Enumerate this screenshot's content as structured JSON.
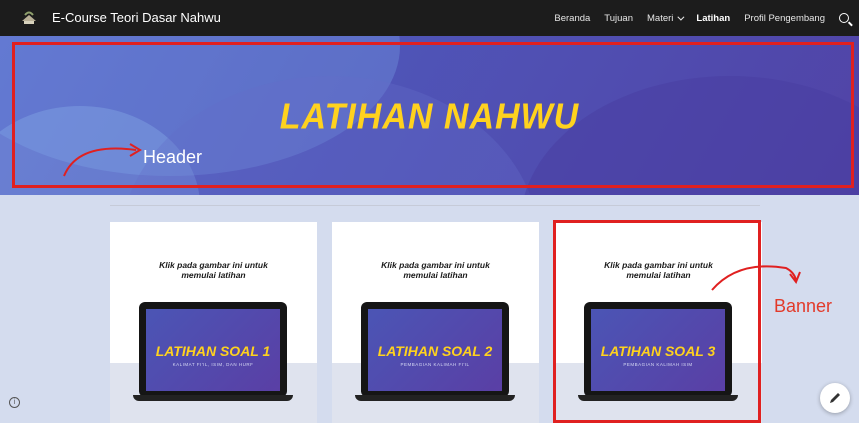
{
  "site": {
    "title": "E-Course Teori Dasar Nahwu"
  },
  "nav": {
    "items": [
      {
        "label": "Beranda",
        "active": false
      },
      {
        "label": "Tujuan",
        "active": false
      },
      {
        "label": "Materi",
        "active": false,
        "dropdown": true
      },
      {
        "label": "Latihan",
        "active": true
      },
      {
        "label": "Profil Pengembang",
        "active": false
      }
    ],
    "search_icon": "search-icon"
  },
  "hero": {
    "title": "LATIHAN NAHWU"
  },
  "annotations": {
    "header": "Header",
    "banner": "Banner"
  },
  "cards": [
    {
      "caption": "Klik pada gambar ini untuk memulai latihan",
      "title": "LATIHAN SOAL 1",
      "subtitle": "KALIMAT FI'IL, ISIM, DAN HURF"
    },
    {
      "caption": "Klik pada gambar ini untuk memulai latihan",
      "title": "LATIHAN SOAL 2",
      "subtitle": "PEMBAGIAN KALIMAH FI'IL"
    },
    {
      "caption": "Klik pada gambar ini untuk memulai latihan",
      "title": "LATIHAN SOAL 3",
      "subtitle": "PEMBAGIAN KALIMAH ISIM"
    }
  ],
  "colors": {
    "nav_bg": "#1c1c1c",
    "hero_title": "#ffd21e",
    "annotation_red": "#e02020",
    "lower_bg": "#d4dcee"
  }
}
